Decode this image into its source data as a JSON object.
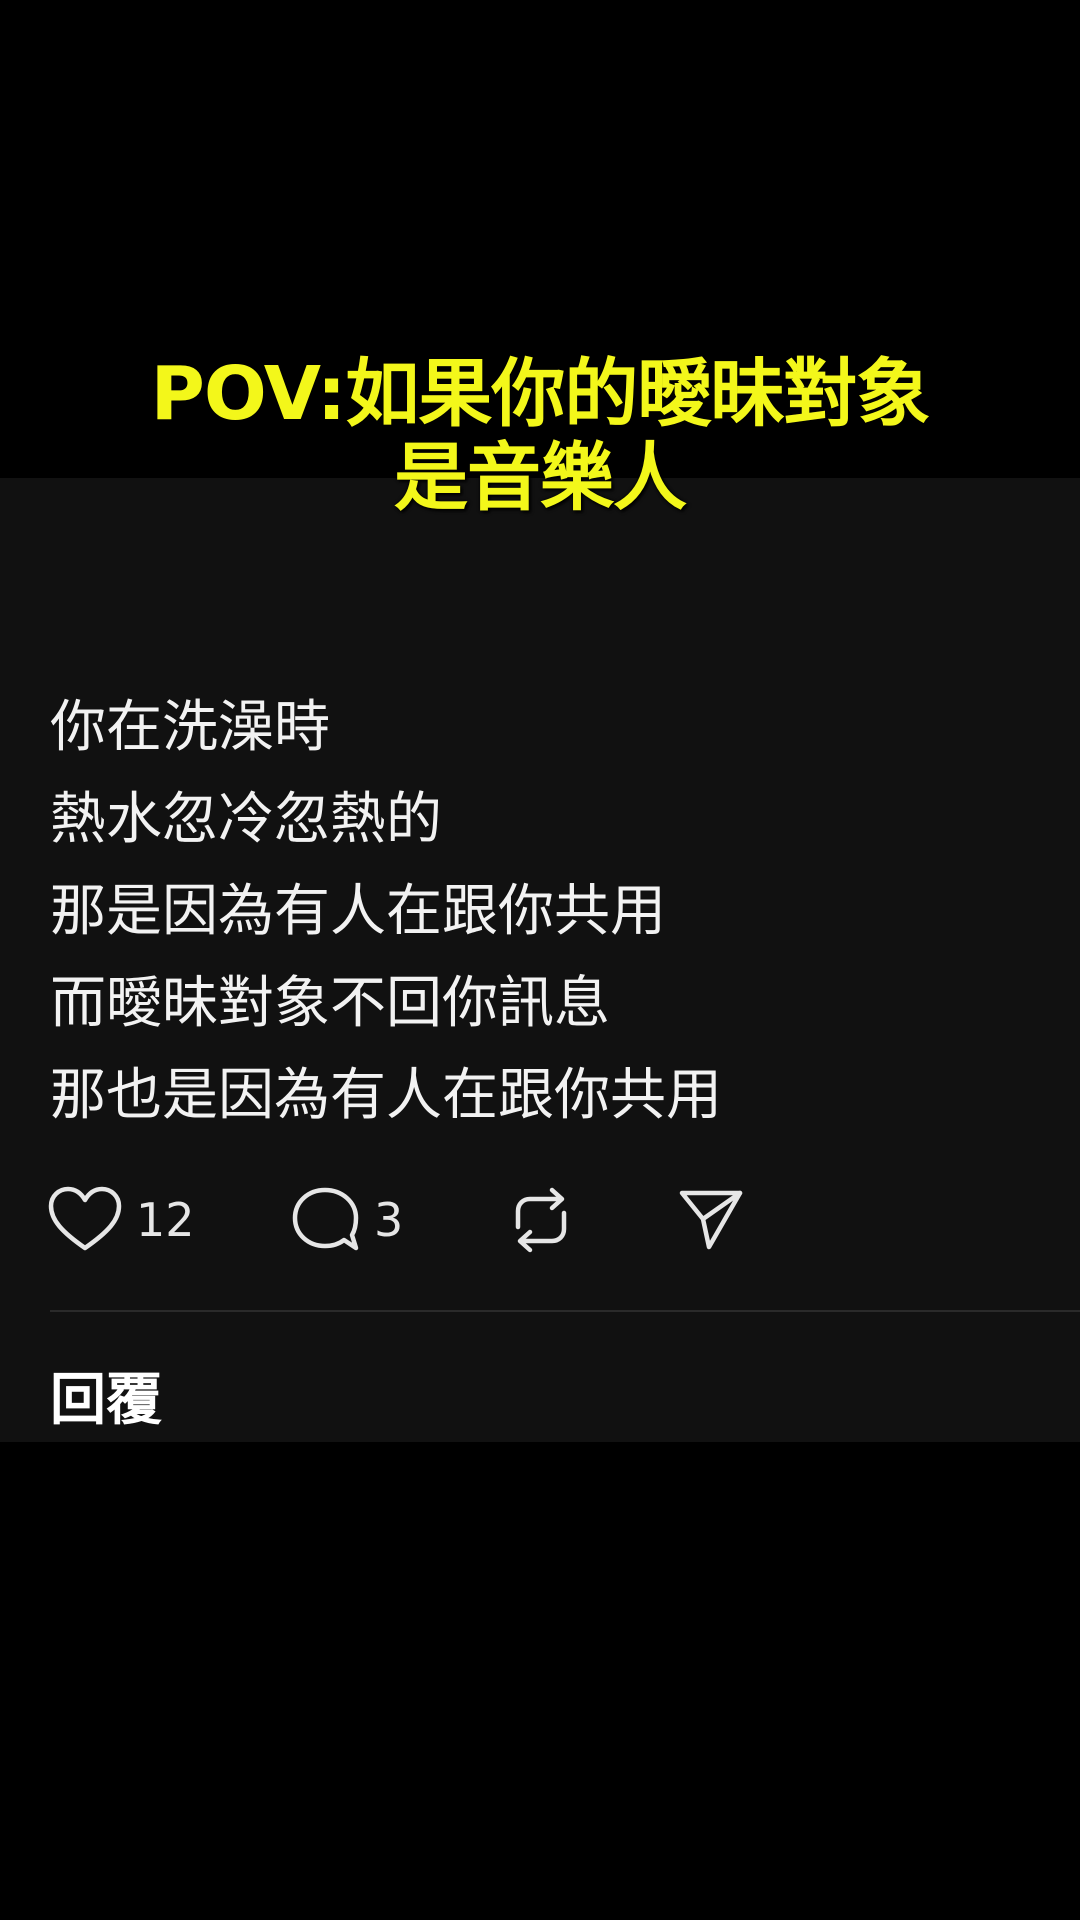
{
  "overlay": {
    "title_line1": "POV:如果你的曖昧對象",
    "title_line2": "是音樂人",
    "title_color": "#f3f71a"
  },
  "post": {
    "lines": [
      "你在洗澡時",
      "熱水忽冷忽熱的",
      "那是因為有人在跟你共用",
      "而曖昧對象不回你訊息",
      "那也是因為有人在跟你共用"
    ]
  },
  "actions": {
    "like": {
      "icon": "heart-icon",
      "count": "12"
    },
    "comment": {
      "icon": "speech-bubble-icon",
      "count": "3"
    },
    "repost": {
      "icon": "repost-icon"
    },
    "share": {
      "icon": "send-icon"
    }
  },
  "replies": {
    "heading": "回覆"
  },
  "colors": {
    "page_background": "#000000",
    "panel_background": "#111111",
    "text": "#f2f2f2"
  }
}
